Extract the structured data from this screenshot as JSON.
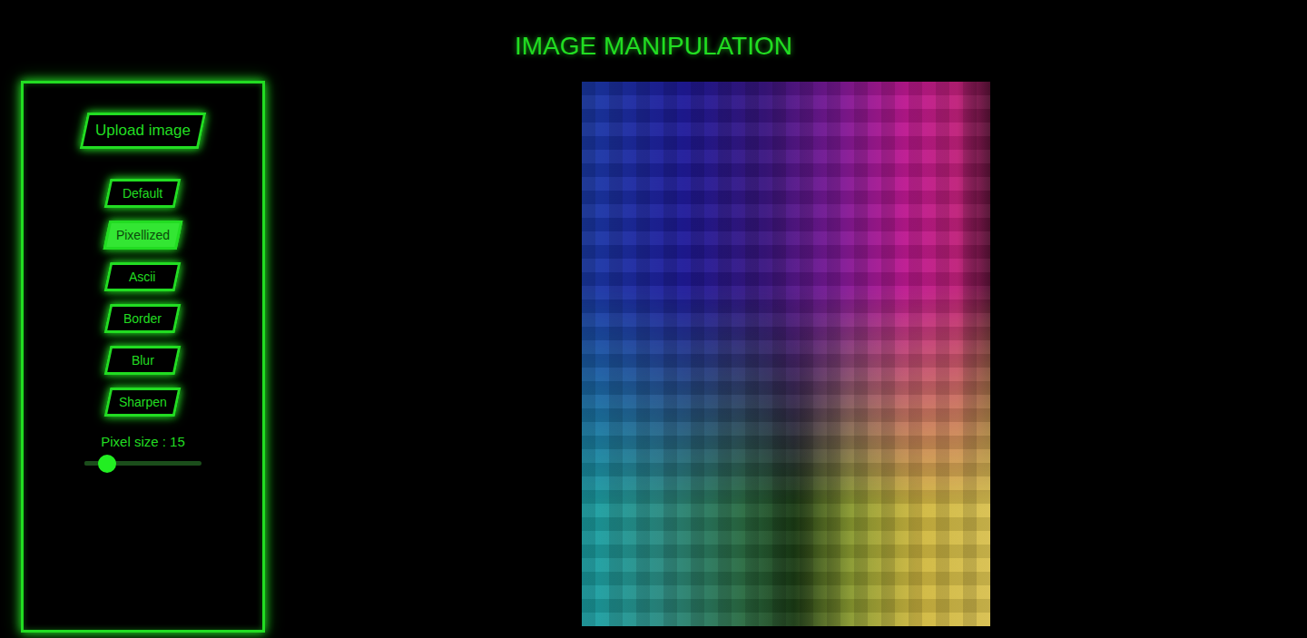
{
  "title": "IMAGE MANIPULATION",
  "upload": {
    "label": "Upload image"
  },
  "filters": [
    {
      "label": "Default",
      "selected": false
    },
    {
      "label": "Pixellized",
      "selected": true
    },
    {
      "label": "Ascii",
      "selected": false
    },
    {
      "label": "Border",
      "selected": false
    },
    {
      "label": "Blur",
      "selected": false
    },
    {
      "label": "Sharpen",
      "selected": false
    }
  ],
  "slider": {
    "label": "Pixel size : 15",
    "level": 0.19
  }
}
